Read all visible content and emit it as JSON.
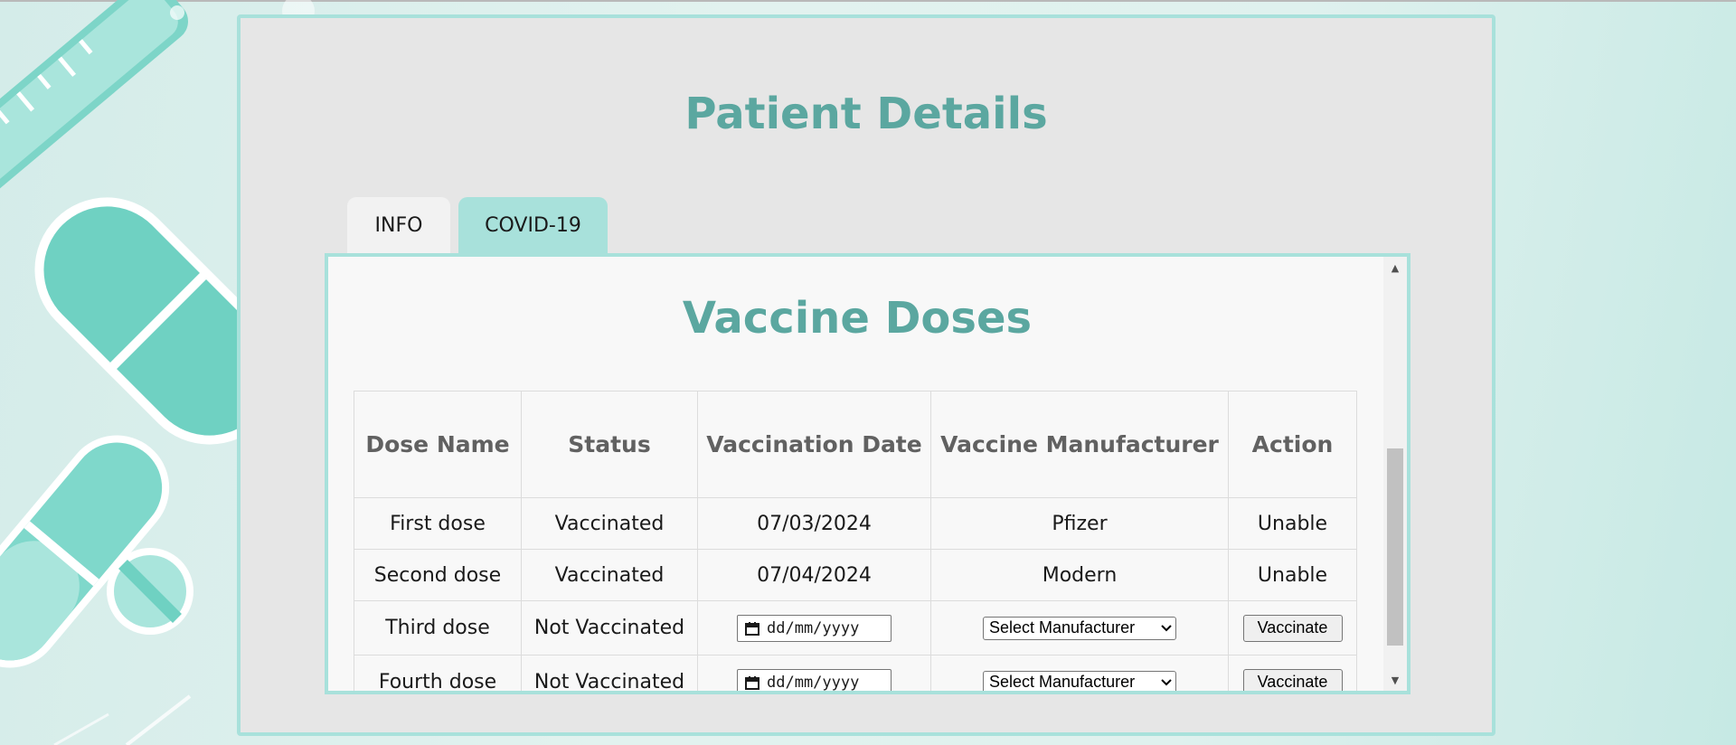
{
  "page": {
    "title": "Patient Details"
  },
  "tabs": [
    {
      "label": "INFO"
    },
    {
      "label": "COVID-19"
    }
  ],
  "vaccine": {
    "title": "Vaccine Doses",
    "columns": [
      "Dose Name",
      "Status",
      "Vaccination Date",
      "Vaccine Manufacturer",
      "Action"
    ],
    "rows": [
      {
        "dose": "First dose",
        "status": "Vaccinated",
        "date": "07/03/2024",
        "manufacturer": "Pfizer",
        "action": "Unable"
      },
      {
        "dose": "Second dose",
        "status": "Vaccinated",
        "date": "07/04/2024",
        "manufacturer": "Modern",
        "action": "Unable"
      },
      {
        "dose": "Third dose",
        "status": "Not Vaccinated",
        "date_placeholder": "dd/mm/yyyy",
        "manufacturer_select": "Select Manufacturer",
        "action_button": "Vaccinate"
      },
      {
        "dose": "Fourth dose",
        "status": "Not Vaccinated",
        "date_placeholder": "dd/mm/yyyy",
        "manufacturer_select": "Select Manufacturer",
        "action_button": "Vaccinate"
      }
    ]
  },
  "colors": {
    "accent": "#5ba7a0",
    "tab_active": "#a8e1db",
    "panel_bg": "#e6e6e6"
  }
}
